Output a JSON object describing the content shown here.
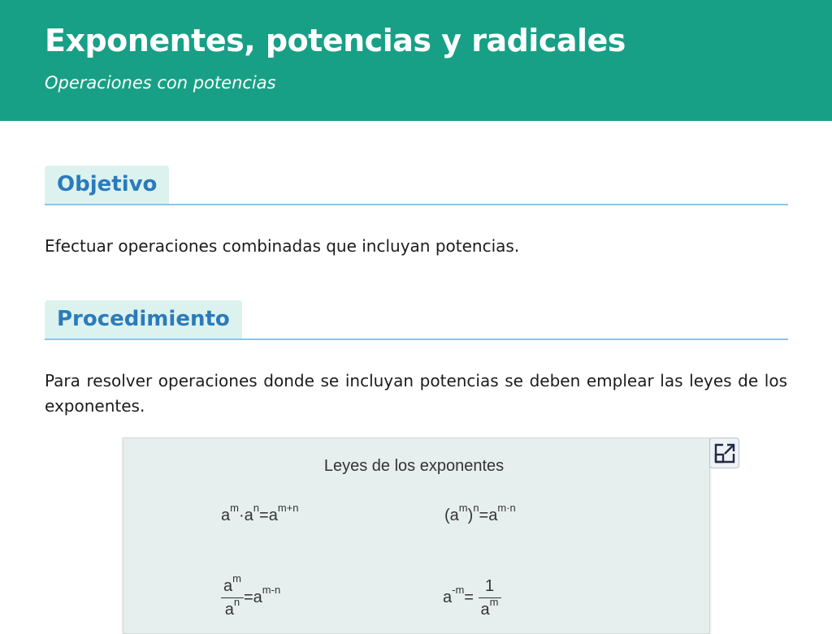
{
  "header": {
    "title": "Exponentes, potencias y radicales",
    "subtitle": "Operaciones con potencias"
  },
  "sections": {
    "objective": {
      "heading": "Objetivo",
      "text": "Efectuar operaciones combinadas que incluyan potencias."
    },
    "procedure": {
      "heading": "Procedimiento",
      "text": "Para resolver operaciones donde se incluyan potencias se deben emplear las leyes de los exponentes."
    }
  },
  "laws_panel": {
    "title": "Leyes de los exponentes",
    "law1": {
      "b1": "a",
      "e1": "m",
      "op": "·",
      "b2": "a",
      "e2": "n",
      "eq": "=",
      "b3": "a",
      "e3": "m+n"
    },
    "law2": {
      "open": "(a",
      "e1": "m",
      "close": ")",
      "e2": "n",
      "eq": "=",
      "b3": "a",
      "e3": "m·n"
    },
    "law3": {
      "num_b": "a",
      "num_e": "m",
      "den_b": "a",
      "den_e": "n",
      "eq": "=",
      "b3": "a",
      "e3": "m-n"
    },
    "law4": {
      "b1": "a",
      "e1": "-m",
      "eq": "=",
      "num": "1",
      "den_b": "a",
      "den_e": "m"
    }
  },
  "icons": {
    "expand": "expand-icon"
  },
  "colors": {
    "header_bg": "#17a085",
    "heading_text": "#2b7bbb",
    "heading_tab_bg": "#dcf2ef",
    "rule": "#8ec4ea",
    "panel_bg": "#e6efee"
  }
}
